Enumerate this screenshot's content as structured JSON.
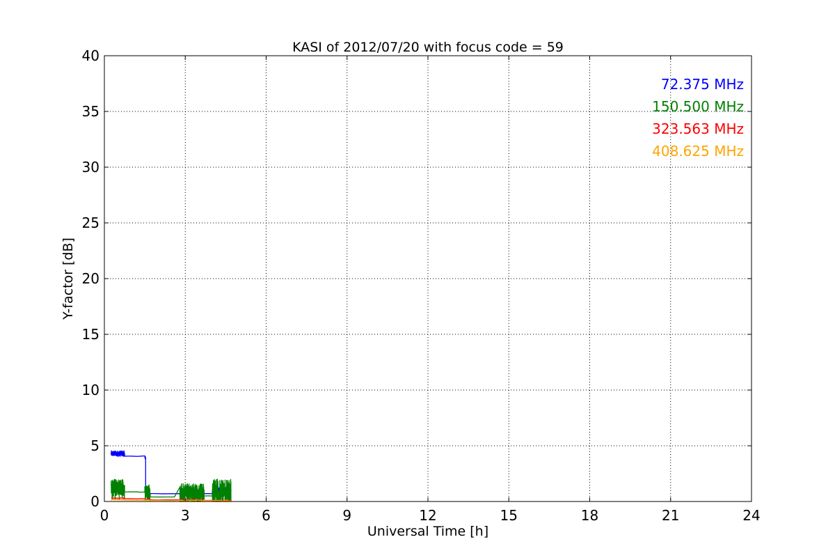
{
  "chart_data": {
    "type": "line",
    "title": "KASI of 2012/07/20 with focus code = 59",
    "xlabel": "Universal Time [h]",
    "ylabel": "Y-factor [dB]",
    "xlim": [
      0,
      24
    ],
    "ylim": [
      0,
      40
    ],
    "xticks": [
      0,
      3,
      6,
      9,
      12,
      15,
      18,
      21,
      24
    ],
    "yticks": [
      0,
      5,
      10,
      15,
      20,
      25,
      30,
      35,
      40
    ],
    "grid": true,
    "legend_position": "top-right",
    "series": [
      {
        "name": "72.375 MHz",
        "color": "#0000ff",
        "segments": [
          {
            "x_start": 0.25,
            "x_end": 0.75,
            "base": 4.3,
            "amp": 0.25,
            "step": 0.004
          },
          {
            "x_start": 0.75,
            "x_end": 1.5,
            "base": 4.05,
            "amp": 0.05,
            "step": 0.15
          },
          {
            "x_start": 1.5,
            "x_end": 1.53,
            "base": 4.0,
            "amp": 0.2,
            "step": 0.01
          },
          {
            "x_start": 1.53,
            "x_end": 1.58,
            "base": 0.95,
            "amp": 0.35,
            "step": 0.004
          },
          {
            "x_start": 1.58,
            "x_end": 2.8,
            "base": 0.7,
            "amp": 0.02,
            "step": 0.3
          },
          {
            "x_start": 2.8,
            "x_end": 3.7,
            "base": 0.85,
            "amp": 0.3,
            "step": 0.006
          },
          {
            "x_start": 3.7,
            "x_end": 4.0,
            "base": 0.7,
            "amp": 0.02,
            "step": 0.1
          },
          {
            "x_start": 4.0,
            "x_end": 4.7,
            "base": 1.0,
            "amp": 0.35,
            "step": 0.006
          }
        ]
      },
      {
        "name": "150.500 MHz",
        "color": "#008000",
        "segments": [
          {
            "x_start": 0.25,
            "x_end": 0.75,
            "base": 1.1,
            "amp": 0.9,
            "step": 0.004
          },
          {
            "x_start": 0.75,
            "x_end": 1.5,
            "base": 0.85,
            "amp": 0.02,
            "step": 0.15
          },
          {
            "x_start": 1.5,
            "x_end": 1.7,
            "base": 0.8,
            "amp": 0.7,
            "step": 0.004
          },
          {
            "x_start": 1.7,
            "x_end": 2.8,
            "base": 0.4,
            "amp": 0.02,
            "step": 0.3
          },
          {
            "x_start": 2.8,
            "x_end": 3.7,
            "base": 0.7,
            "amp": 0.9,
            "step": 0.004
          },
          {
            "x_start": 3.7,
            "x_end": 4.0,
            "base": 0.5,
            "amp": 0.02,
            "step": 0.1
          },
          {
            "x_start": 4.0,
            "x_end": 4.7,
            "base": 0.8,
            "amp": 1.2,
            "step": 0.004
          }
        ]
      },
      {
        "name": "323.563 MHz",
        "color": "#ff0000",
        "segments": [
          {
            "x_start": 0.25,
            "x_end": 0.75,
            "base": 0.3,
            "amp": 0.05,
            "step": 0.02
          },
          {
            "x_start": 0.75,
            "x_end": 1.5,
            "base": 0.25,
            "amp": 0.01,
            "step": 0.15
          },
          {
            "x_start": 1.5,
            "x_end": 1.7,
            "base": 0.2,
            "amp": 0.05,
            "step": 0.02
          },
          {
            "x_start": 1.7,
            "x_end": 2.8,
            "base": 0.15,
            "amp": 0.01,
            "step": 0.3
          },
          {
            "x_start": 2.8,
            "x_end": 3.7,
            "base": 0.15,
            "amp": 0.05,
            "step": 0.02
          },
          {
            "x_start": 3.7,
            "x_end": 4.0,
            "base": 0.1,
            "amp": 0.01,
            "step": 0.1
          },
          {
            "x_start": 4.0,
            "x_end": 4.7,
            "base": 0.1,
            "amp": 0.05,
            "step": 0.02
          }
        ]
      },
      {
        "name": "408.625 MHz",
        "color": "#ffa500",
        "segments": [
          {
            "x_start": 0.25,
            "x_end": 0.75,
            "base": 0.15,
            "amp": 0.05,
            "step": 0.02
          },
          {
            "x_start": 0.75,
            "x_end": 1.5,
            "base": 0.12,
            "amp": 0.01,
            "step": 0.15
          },
          {
            "x_start": 1.5,
            "x_end": 1.7,
            "base": 0.12,
            "amp": 0.05,
            "step": 0.02
          },
          {
            "x_start": 1.7,
            "x_end": 2.8,
            "base": 0.1,
            "amp": 0.01,
            "step": 0.3
          },
          {
            "x_start": 2.8,
            "x_end": 3.7,
            "base": 0.1,
            "amp": 0.05,
            "step": 0.02
          },
          {
            "x_start": 3.7,
            "x_end": 4.0,
            "base": 0.08,
            "amp": 0.01,
            "step": 0.1
          },
          {
            "x_start": 4.0,
            "x_end": 4.7,
            "base": 0.08,
            "amp": 0.05,
            "step": 0.02
          }
        ]
      }
    ]
  }
}
